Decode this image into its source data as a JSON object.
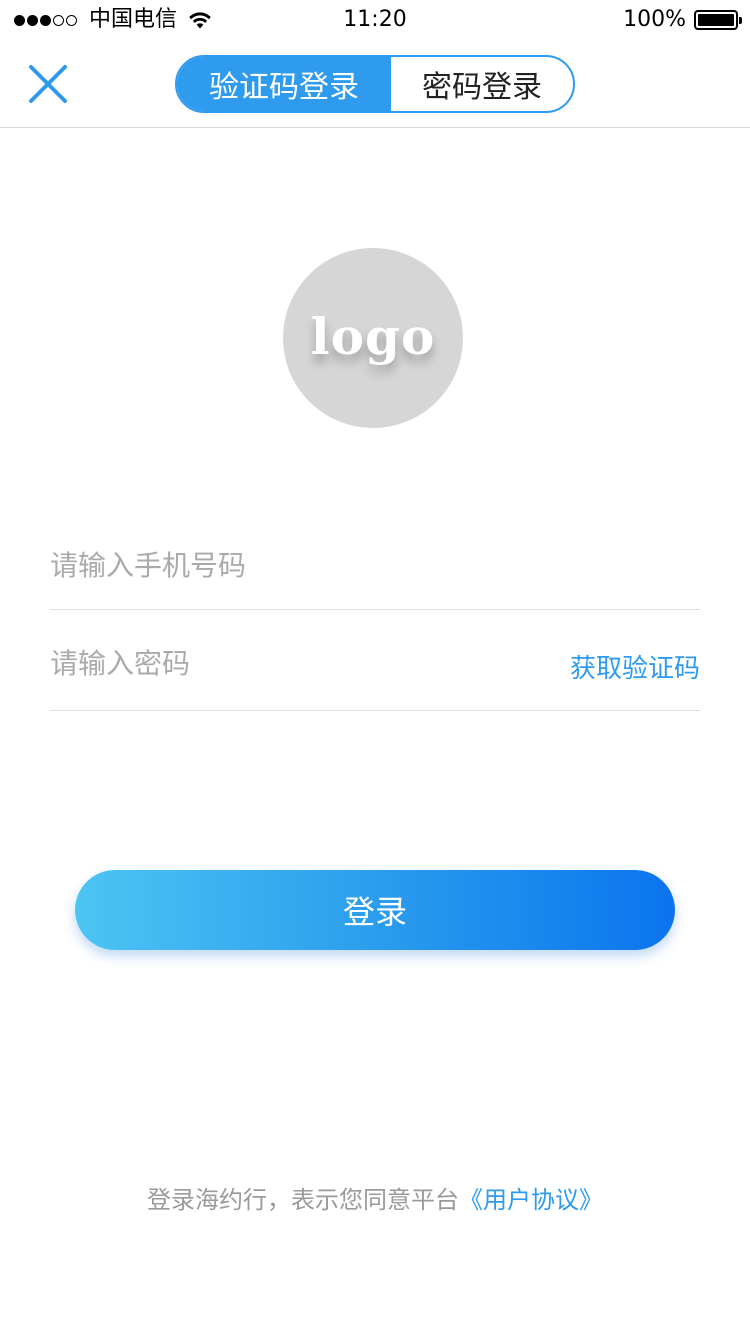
{
  "status_bar": {
    "carrier": "中国电信",
    "time": "11:20",
    "battery_percent": "100%",
    "signal_bars_filled": 3,
    "signal_bars_total": 5
  },
  "nav": {
    "tabs": [
      {
        "label": "验证码登录",
        "active": true
      },
      {
        "label": "密码登录",
        "active": false
      }
    ]
  },
  "logo": {
    "text": "logo"
  },
  "form": {
    "phone_placeholder": "请输入手机号码",
    "phone_value": "",
    "code_placeholder": "请输入密码",
    "code_value": "",
    "get_code_label": "获取验证码"
  },
  "login_button": {
    "label": "登录"
  },
  "agreement": {
    "prefix": "登录海约行，表示您同意平台",
    "link": "《用户协议》"
  },
  "colors": {
    "accent": "#2e9bee",
    "gradient_start": "#4ec4f3",
    "gradient_end": "#0b74ee",
    "logo_bg": "#d6d6d6",
    "placeholder": "#aaaaaa",
    "divider": "#dedede"
  }
}
